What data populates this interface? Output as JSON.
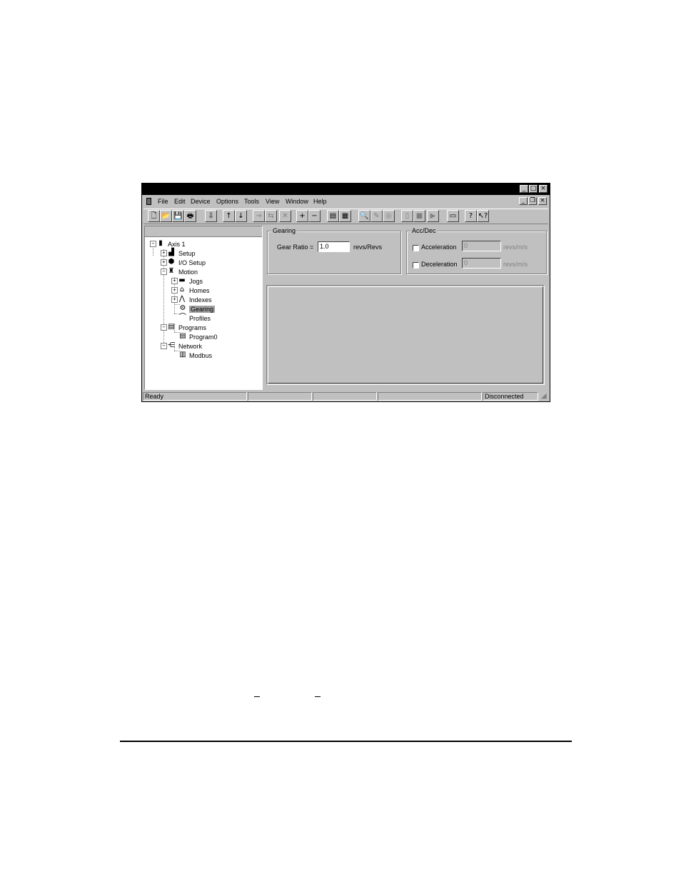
{
  "window": {
    "title_buttons": {
      "minimize": "_",
      "maximize": "□",
      "close": "×"
    },
    "mdi_buttons": {
      "minimize": "_",
      "restore": "❐",
      "close": "×"
    }
  },
  "menu": {
    "items": [
      {
        "label": "File"
      },
      {
        "label": "Edit"
      },
      {
        "label": "Device"
      },
      {
        "label": "Options"
      },
      {
        "label": "Tools"
      },
      {
        "label": "View"
      },
      {
        "label": "Window"
      },
      {
        "label": "Help"
      }
    ]
  },
  "toolbar": {
    "buttons": [
      {
        "name": "new-file-icon",
        "glyph": "🗋"
      },
      {
        "name": "open-folder-icon",
        "glyph": "📂"
      },
      {
        "name": "save-icon",
        "glyph": "💾"
      },
      {
        "name": "print-icon",
        "glyph": "🖶"
      },
      {
        "name": "download-icon",
        "glyph": "⇩"
      },
      {
        "name": "upload-icon",
        "glyph": "↑"
      },
      {
        "name": "download-to-device-icon",
        "glyph": "↓"
      },
      {
        "name": "connect-icon",
        "glyph": "→"
      },
      {
        "name": "disconnect-icon",
        "glyph": "⇆"
      },
      {
        "name": "cut-icon",
        "glyph": "✕"
      },
      {
        "name": "add-icon",
        "glyph": "+"
      },
      {
        "name": "remove-icon",
        "glyph": "−"
      },
      {
        "name": "properties-icon",
        "glyph": "▤"
      },
      {
        "name": "document-icon",
        "glyph": "▦"
      },
      {
        "name": "zoom-icon",
        "glyph": "🔍"
      },
      {
        "name": "pen-icon",
        "glyph": "✎"
      },
      {
        "name": "watch-icon",
        "glyph": "◎"
      },
      {
        "name": "stop-icon",
        "glyph": "▯"
      },
      {
        "name": "halt-icon",
        "glyph": "■"
      },
      {
        "name": "run-icon",
        "glyph": "▶"
      },
      {
        "name": "window-icon",
        "glyph": "▭"
      },
      {
        "name": "about-icon",
        "glyph": "?"
      },
      {
        "name": "help-pointer-icon",
        "glyph": "↖?"
      }
    ]
  },
  "tree": {
    "nodes": [
      {
        "label": "Axis 1"
      },
      {
        "label": "Setup"
      },
      {
        "label": "I/O Setup"
      },
      {
        "label": "Motion"
      },
      {
        "label": "Jogs"
      },
      {
        "label": "Homes"
      },
      {
        "label": "Indexes"
      },
      {
        "label": "Gearing"
      },
      {
        "label": "Profiles"
      },
      {
        "label": "Programs"
      },
      {
        "label": "Program0"
      },
      {
        "label": "Network"
      },
      {
        "label": "Modbus"
      }
    ],
    "expander_plus": "+",
    "expander_minus": "−"
  },
  "gearing": {
    "title": "Gearing",
    "ratio_label": "Gear Ratio =",
    "ratio_value": "1.0",
    "unit": "revs/Revs"
  },
  "accdec": {
    "title": "Acc/Dec",
    "acceleration_label": "Acceleration",
    "acceleration_value": "0",
    "acceleration_unit": "revs/m/s",
    "deceleration_label": "Deceleration",
    "deceleration_value": "0",
    "deceleration_unit": "revs/m/s"
  },
  "status": {
    "left": "Ready",
    "right": "Disconnected"
  }
}
